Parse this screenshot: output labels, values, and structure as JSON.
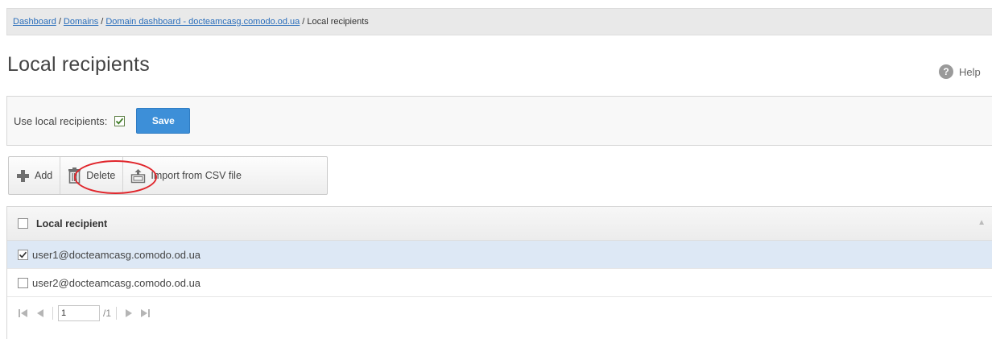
{
  "breadcrumb": {
    "items": [
      "Dashboard",
      "Domains",
      "Domain dashboard - docteamcasg.comodo.od.ua"
    ],
    "current": "Local recipients",
    "separator": "/"
  },
  "page": {
    "title": "Local recipients"
  },
  "help": {
    "label": "Help",
    "icon": "question-circle-icon"
  },
  "settings": {
    "use_local_label": "Use local recipients:",
    "use_local_checked": true,
    "save_label": "Save"
  },
  "toolbar": {
    "add_label": "Add",
    "delete_label": "Delete",
    "import_label": "Import from CSV file"
  },
  "grid": {
    "column_header": "Local recipient",
    "rows": [
      {
        "email": "user1@docteamcasg.comodo.od.ua",
        "checked": true
      },
      {
        "email": "user2@docteamcasg.comodo.od.ua",
        "checked": false
      }
    ]
  },
  "pager": {
    "current_page": "1",
    "total": "/1"
  },
  "colors": {
    "accent": "#3d8fd8",
    "link": "#2a6ebb",
    "highlight_ring": "#e0262c",
    "selected_row": "#dde8f5"
  }
}
